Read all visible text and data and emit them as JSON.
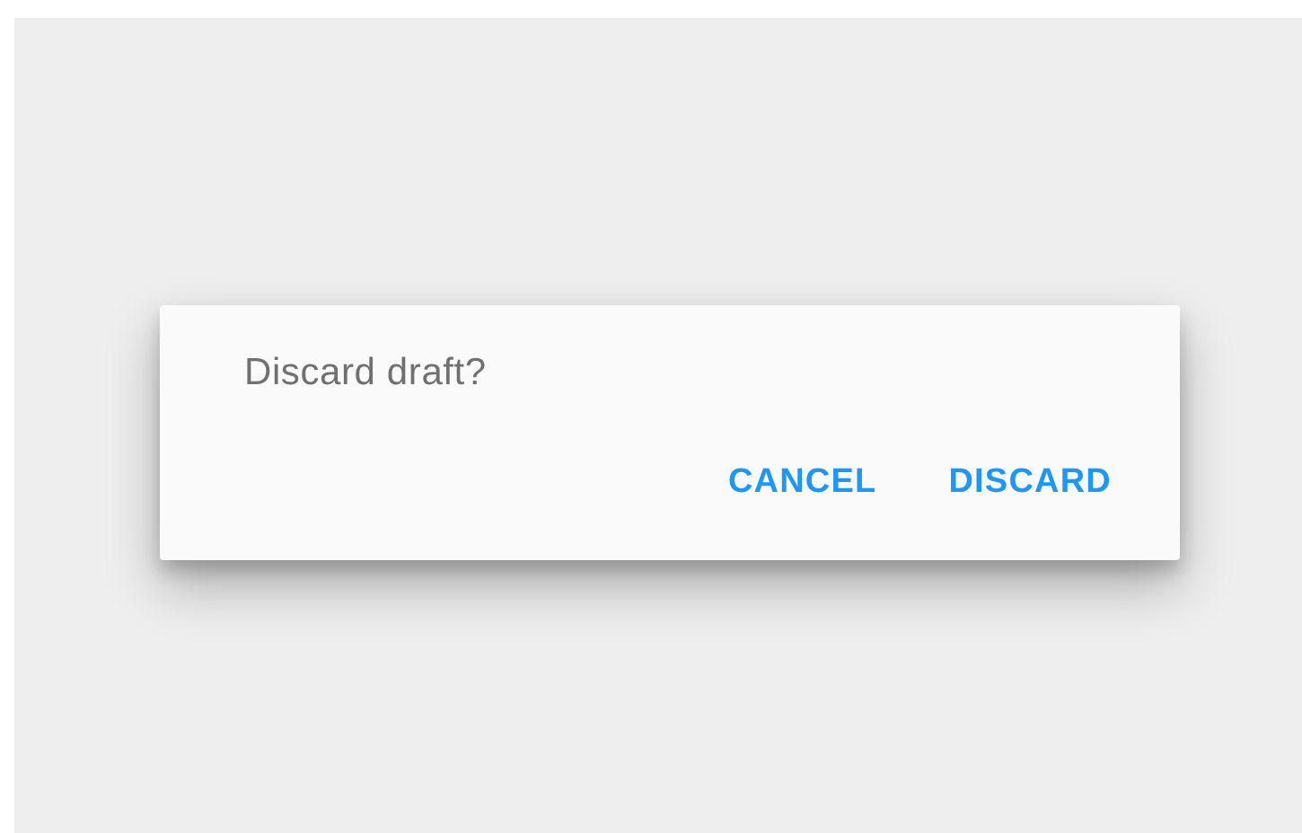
{
  "dialog": {
    "message": "Discard draft?",
    "buttons": [
      {
        "label": "CANCEL"
      },
      {
        "label": "DISCARD"
      }
    ]
  }
}
